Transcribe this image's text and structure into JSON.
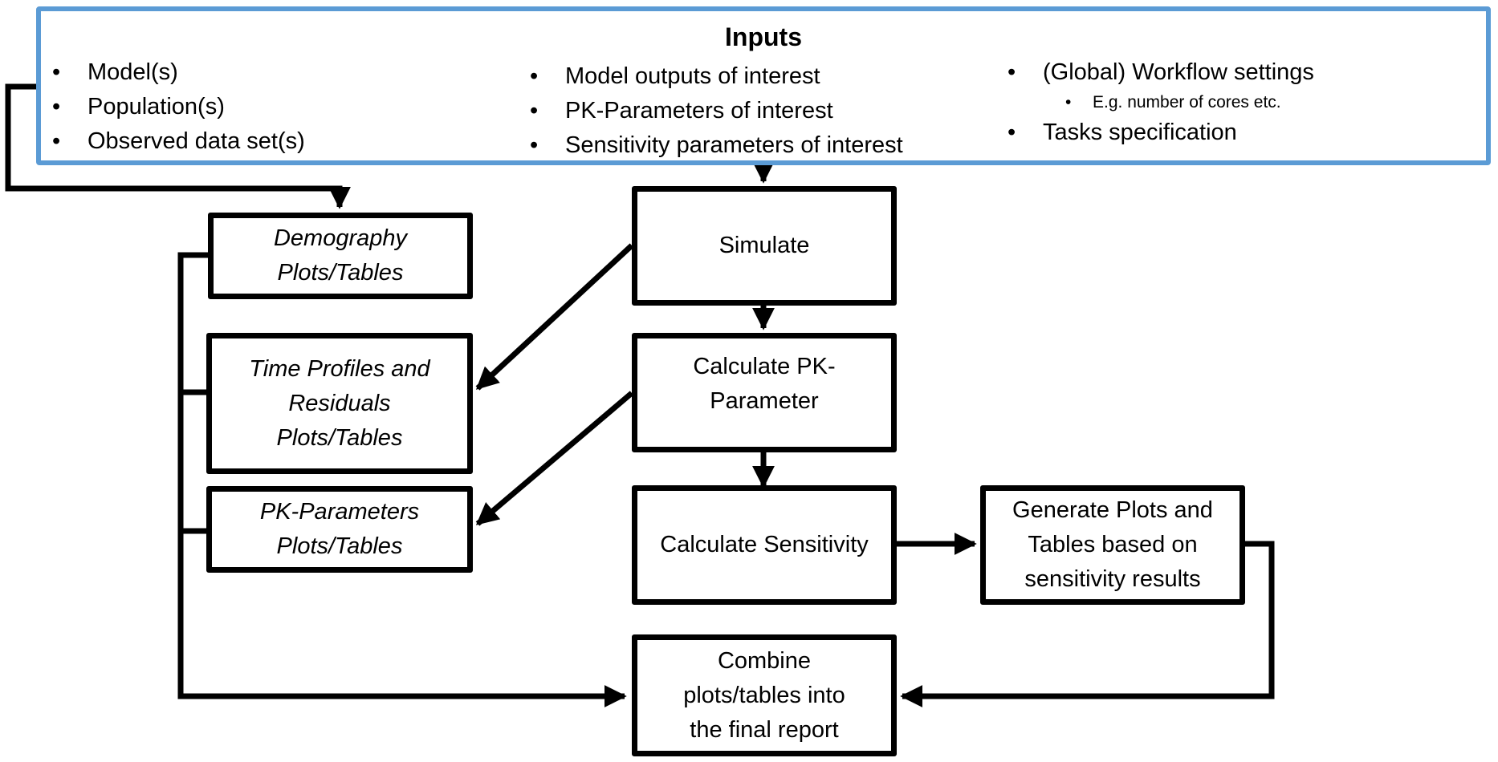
{
  "inputs": {
    "title": "Inputs",
    "border_color": "#5b9bd5",
    "column1": [
      "Model(s)",
      "Population(s)",
      "Observed data set(s)"
    ],
    "column2": [
      "Model outputs of interest",
      "PK-Parameters of interest",
      "Sensitivity parameters of interest"
    ],
    "column3": [
      {
        "text": "(Global) Workflow settings",
        "level": 1
      },
      {
        "text": "E.g. number of cores etc.",
        "level": 2
      },
      {
        "text": "Tasks specification",
        "level": 1
      }
    ]
  },
  "nodes": {
    "demography": "Demography\nPlots/Tables",
    "time_profiles": "Time Profiles and\nResiduals\nPlots/Tables",
    "pk_parameters_plots": "PK-Parameters\nPlots/Tables",
    "simulate": "Simulate",
    "calculate_pk": "Calculate PK-\nParameter",
    "calculate_sensitivity": "Calculate Sensitivity",
    "generate_sensitivity_plots": "Generate Plots and\nTables based on\nsensitivity results",
    "combine_report": "Combine\nplots/tables into\nthe final report"
  },
  "edges": [
    {
      "from": "inputs",
      "to": "demography"
    },
    {
      "from": "inputs",
      "to": "simulate"
    },
    {
      "from": "simulate",
      "to": "calculate_pk"
    },
    {
      "from": "simulate",
      "to": "time_profiles"
    },
    {
      "from": "calculate_pk",
      "to": "pk_parameters_plots"
    },
    {
      "from": "calculate_pk",
      "to": "calculate_sensitivity"
    },
    {
      "from": "calculate_sensitivity",
      "to": "generate_sensitivity_plots"
    },
    {
      "from": "generate_sensitivity_plots",
      "to": "combine_report"
    },
    {
      "from": "demography",
      "to": "combine_report"
    },
    {
      "from": "time_profiles",
      "to": "combine_report"
    },
    {
      "from": "pk_parameters_plots",
      "to": "combine_report"
    }
  ]
}
